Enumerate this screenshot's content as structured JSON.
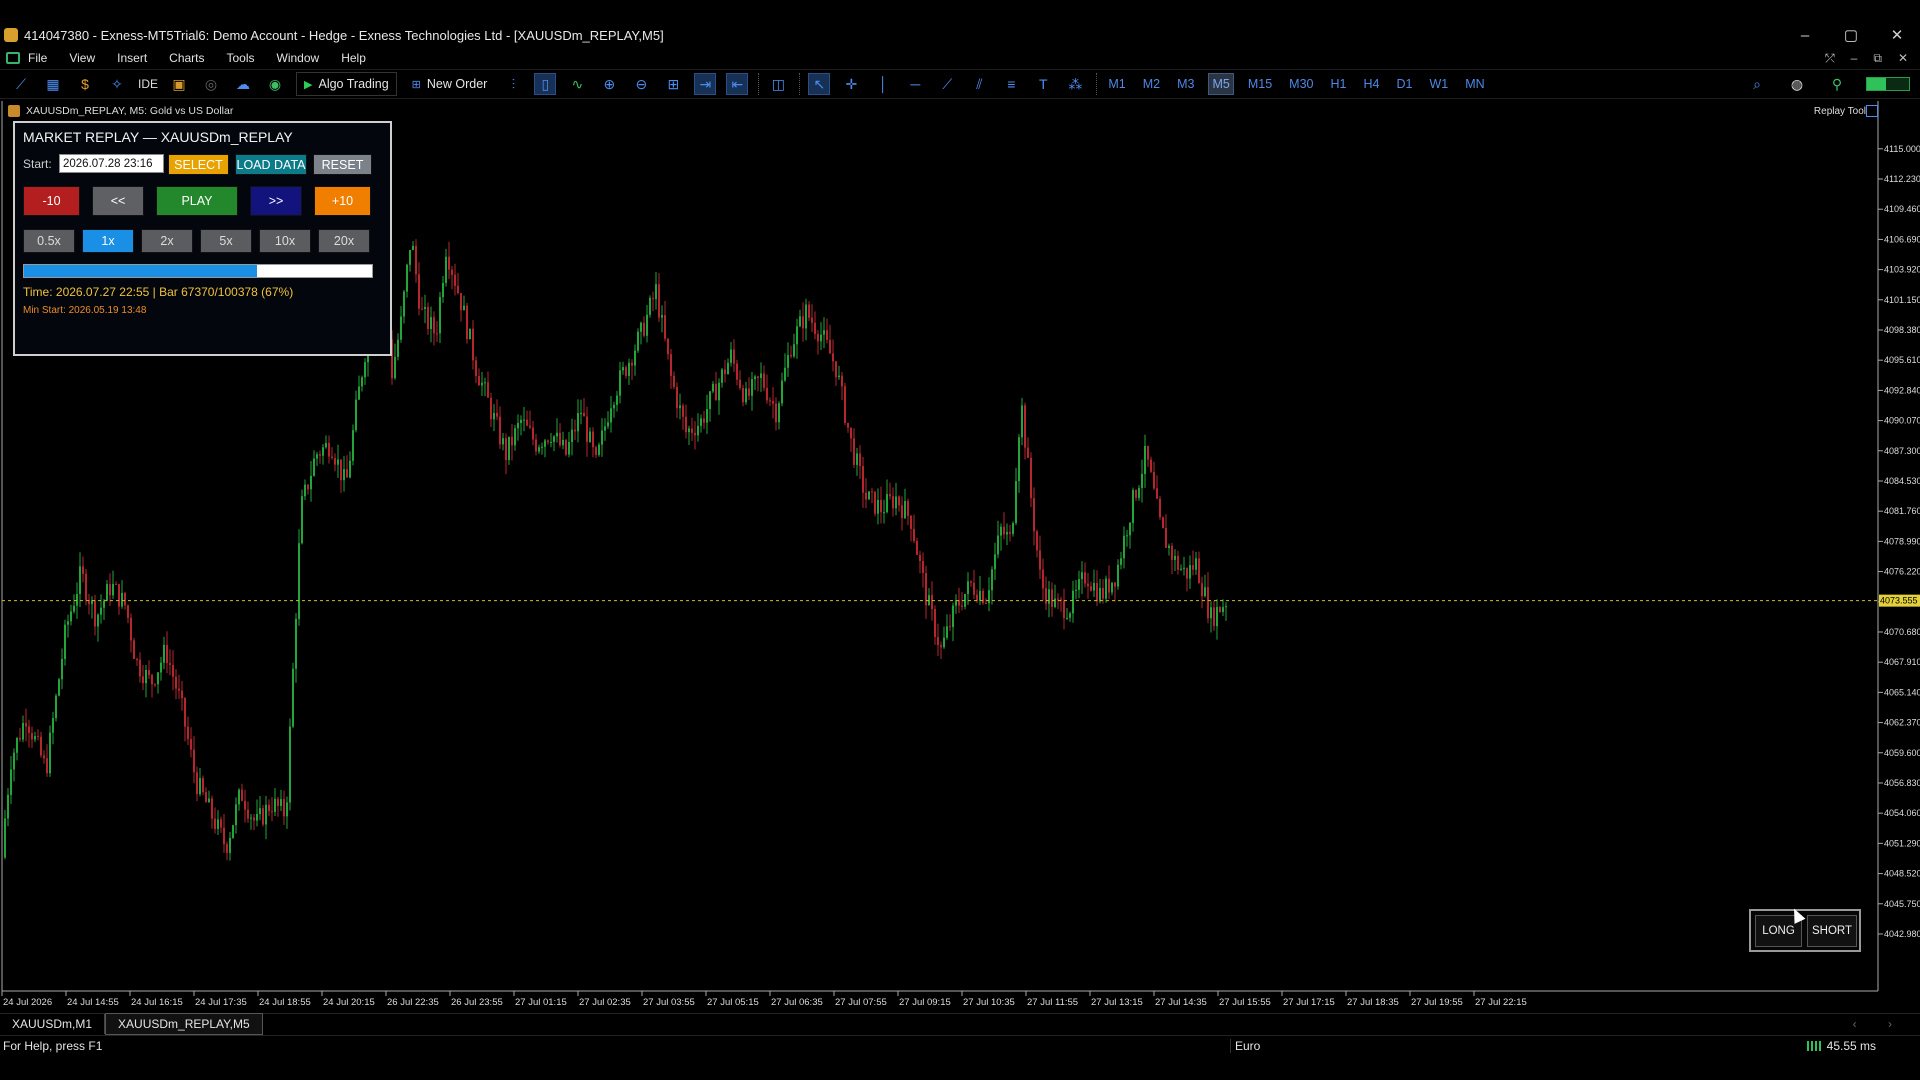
{
  "window": {
    "title": "414047380 - Exness-MT5Trial6: Demo Account - Hedge - Exness Technologies Ltd - [XAUUSDm_REPLAY,M5]",
    "controls": [
      "–",
      "▢",
      "✕"
    ]
  },
  "menu": {
    "items": [
      "File",
      "View",
      "Insert",
      "Charts",
      "Tools",
      "Window",
      "Help"
    ],
    "right_controls": [
      "⤱",
      "–",
      "⧉",
      "✕"
    ]
  },
  "toolbar": {
    "ide_label": "IDE",
    "algo_trading_label": "Algo Trading",
    "new_order_label": "New Order",
    "timeframes": [
      "M1",
      "M2",
      "M3",
      "M5",
      "M15",
      "M30",
      "H1",
      "H4",
      "D1",
      "W1",
      "MN"
    ],
    "active_timeframe": "M5"
  },
  "chart": {
    "header": "XAUUSDm_REPLAY, M5:  Gold vs US Dollar",
    "replay_tool_label": "Replay Tool",
    "current_price_label": "4073.555",
    "colors": {
      "bull": "#22a63a",
      "bear": "#b5262d",
      "current_line": "#c8c030",
      "price_tag": "#e5d23a"
    }
  },
  "chart_data": {
    "type": "candlestick",
    "y_ticks": [
      "4115.000",
      "4112.230",
      "4109.460",
      "4106.690",
      "4103.920",
      "4101.150",
      "4098.380",
      "4095.610",
      "4092.840",
      "4090.070",
      "4087.300",
      "4084.530",
      "4081.760",
      "4078.990",
      "4076.220",
      "4073.450",
      "4070.680",
      "4067.910",
      "4065.140",
      "4062.370",
      "4059.600",
      "4056.830",
      "4054.060",
      "4051.290",
      "4048.520",
      "4045.750",
      "4042.980"
    ],
    "ylim": [
      4040.5,
      4117.0
    ],
    "x_ticks": [
      "24 Jul 2026",
      "24 Jul 14:55",
      "24 Jul 16:15",
      "24 Jul 17:35",
      "24 Jul 18:55",
      "24 Jul 20:15",
      "26 Jul 22:35",
      "26 Jul 23:55",
      "27 Jul 01:15",
      "27 Jul 02:35",
      "27 Jul 03:55",
      "27 Jul 05:15",
      "27 Jul 06:35",
      "27 Jul 07:55",
      "27 Jul 09:15",
      "27 Jul 10:35",
      "27 Jul 11:55",
      "27 Jul 13:15",
      "27 Jul 14:35",
      "27 Jul 15:55",
      "27 Jul 17:15",
      "27 Jul 18:35",
      "27 Jul 19:55",
      "27 Jul 22:15"
    ],
    "current_price": 4073.555,
    "close_path": [
      [
        0,
        4050.0
      ],
      [
        10,
        4059.0
      ],
      [
        25,
        4063.0
      ],
      [
        45,
        4058.0
      ],
      [
        65,
        4071.0
      ],
      [
        80,
        4076.0
      ],
      [
        95,
        4072.0
      ],
      [
        110,
        4075.0
      ],
      [
        125,
        4073.0
      ],
      [
        135,
        4068.0
      ],
      [
        150,
        4066.0
      ],
      [
        165,
        4069.0
      ],
      [
        180,
        4064.0
      ],
      [
        195,
        4057.0
      ],
      [
        210,
        4054.0
      ],
      [
        225,
        4051.0
      ],
      [
        240,
        4056.0
      ],
      [
        255,
        4053.0
      ],
      [
        270,
        4055.0
      ],
      [
        285,
        4054.0
      ],
      [
        300,
        4082.0
      ],
      [
        315,
        4087.0
      ],
      [
        330,
        4088.0
      ],
      [
        345,
        4084.0
      ],
      [
        355,
        4091.0
      ],
      [
        370,
        4100.0
      ],
      [
        380,
        4112.0
      ],
      [
        390,
        4094.0
      ],
      [
        400,
        4099.0
      ],
      [
        410,
        4107.0
      ],
      [
        420,
        4100.0
      ],
      [
        435,
        4098.0
      ],
      [
        445,
        4106.0
      ],
      [
        460,
        4101.0
      ],
      [
        475,
        4095.0
      ],
      [
        490,
        4091.0
      ],
      [
        505,
        4087.0
      ],
      [
        520,
        4090.0
      ],
      [
        535,
        4088.0
      ],
      [
        550,
        4089.0
      ],
      [
        565,
        4087.0
      ],
      [
        580,
        4091.0
      ],
      [
        595,
        4086.0
      ],
      [
        610,
        4092.0
      ],
      [
        625,
        4095.0
      ],
      [
        640,
        4098.0
      ],
      [
        655,
        4102.0
      ],
      [
        670,
        4094.0
      ],
      [
        685,
        4089.0
      ],
      [
        700,
        4090.0
      ],
      [
        715,
        4093.0
      ],
      [
        730,
        4096.0
      ],
      [
        745,
        4092.0
      ],
      [
        760,
        4094.0
      ],
      [
        775,
        4091.0
      ],
      [
        790,
        4097.0
      ],
      [
        805,
        4100.0
      ],
      [
        820,
        4098.0
      ],
      [
        835,
        4095.0
      ],
      [
        850,
        4088.0
      ],
      [
        865,
        4083.0
      ],
      [
        880,
        4082.0
      ],
      [
        895,
        4083.0
      ],
      [
        910,
        4081.0
      ],
      [
        925,
        4074.0
      ],
      [
        940,
        4069.0
      ],
      [
        955,
        4073.0
      ],
      [
        970,
        4075.0
      ],
      [
        985,
        4074.0
      ],
      [
        1000,
        4080.0
      ],
      [
        1010,
        4079.0
      ],
      [
        1020,
        4092.0
      ],
      [
        1030,
        4083.0
      ],
      [
        1040,
        4075.0
      ],
      [
        1055,
        4073.0
      ],
      [
        1070,
        4073.0
      ],
      [
        1085,
        4076.0
      ],
      [
        1100,
        4074.0
      ],
      [
        1115,
        4076.0
      ],
      [
        1130,
        4082.0
      ],
      [
        1145,
        4087.0
      ],
      [
        1160,
        4080.0
      ],
      [
        1175,
        4077.0
      ],
      [
        1185,
        4076.0
      ],
      [
        1195,
        4077.0
      ],
      [
        1210,
        4072.0
      ],
      [
        1225,
        4073.555
      ]
    ]
  },
  "replay_panel": {
    "title": "MARKET REPLAY — XAUUSDm_REPLAY",
    "start_label": "Start:",
    "start_value": "2026.07.28 23:16",
    "select_label": "SELECT",
    "load_label": "LOAD DATA",
    "reset_label": "RESET",
    "minus10_label": "-10",
    "back_label": "<<",
    "play_label": "PLAY",
    "fwd_label": ">>",
    "plus10_label": "+10",
    "speeds": [
      "0.5x",
      "1x",
      "2x",
      "5x",
      "10x",
      "20x"
    ],
    "active_speed": "1x",
    "progress": 0.67,
    "status": "Time: 2026.07.27 22:55 | Bar 67370/100378 (67%)",
    "min_start": "Min Start: 2026.05.19 13:48"
  },
  "trade_panel": {
    "long_label": "LONG",
    "short_label": "SHORT"
  },
  "tabs": {
    "items": [
      "XAUUSDm,M1",
      "XAUUSDm_REPLAY,M5"
    ],
    "active": 1,
    "nav": "‹ ›"
  },
  "status_bar": {
    "help": "For Help, press F1",
    "profile": "Euro",
    "ping": "45.55 ms"
  }
}
